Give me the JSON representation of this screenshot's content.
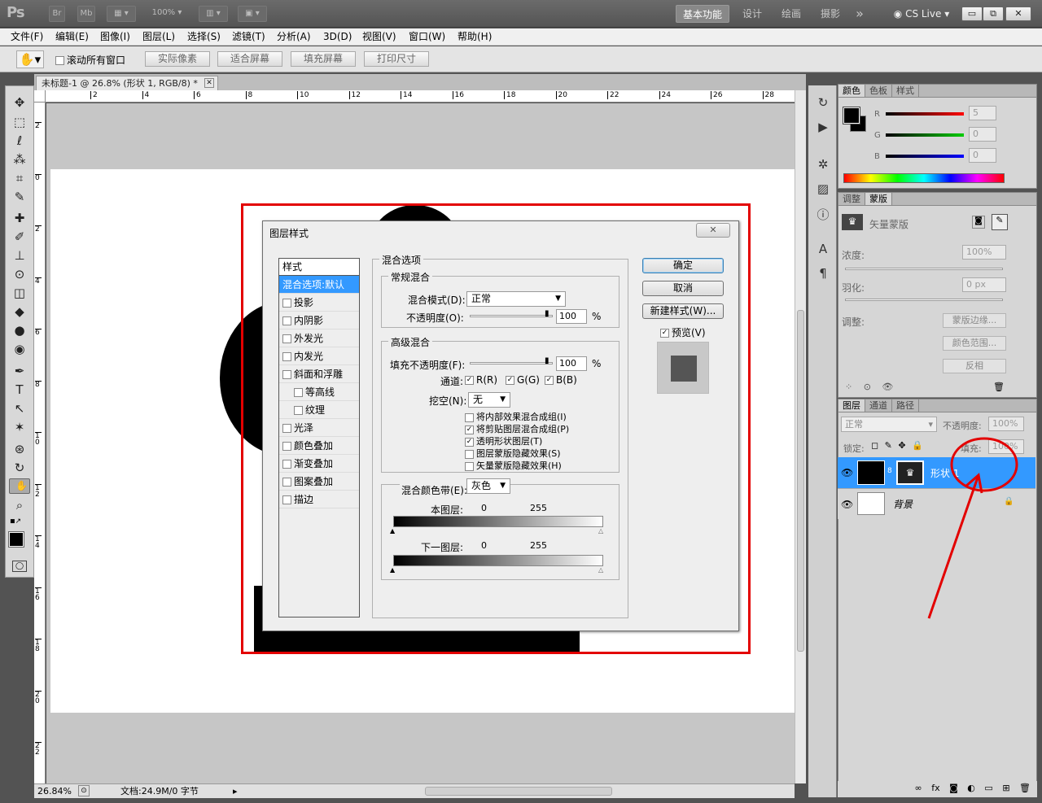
{
  "app": {
    "logo": "Ps",
    "br_label": "Br",
    "mb_label": "Mb",
    "zoom_select": "100%",
    "workspaces": [
      "基本功能",
      "设计",
      "绘画",
      "摄影"
    ],
    "more": "»",
    "cslive": "CS Live",
    "win_min": "▭",
    "win_max": "⧉",
    "win_close": "✕"
  },
  "menubar": [
    "文件(F)",
    "编辑(E)",
    "图像(I)",
    "图层(L)",
    "选择(S)",
    "滤镜(T)",
    "分析(A)",
    "3D(D)",
    "视图(V)",
    "窗口(W)",
    "帮助(H)"
  ],
  "options": {
    "scroll_all": "滚动所有窗口",
    "buttons": [
      "实际像素",
      "适合屏幕",
      "填充屏幕",
      "打印尺寸"
    ]
  },
  "document": {
    "tab_title": "未标题-1 @ 26.8% (形状 1, RGB/8) *",
    "zoom": "26.84%",
    "doc_size": "文档:24.9M/0 字节"
  },
  "rulers": {
    "top": [
      "2",
      "4",
      "6",
      "8",
      "10",
      "12",
      "14",
      "16",
      "18",
      "20",
      "22",
      "24",
      "26",
      "28"
    ],
    "left": [
      "2",
      "0",
      "2",
      "4",
      "6",
      "8",
      "1 0",
      "1 2",
      "1 4",
      "1 6",
      "1 8",
      "2 0",
      "2 2"
    ]
  },
  "tools": [
    "✥",
    "⬚",
    "ℓ",
    "⁂",
    "⌗",
    "✎",
    "✚",
    "✐",
    "⊥",
    "⊙",
    "◫",
    "◆",
    "●",
    "◉",
    "✒",
    "T",
    "↖",
    "✶",
    "⊛",
    "↻",
    "✋",
    "⌕"
  ],
  "dialog": {
    "title": "图层样式",
    "styles_header": "样式",
    "styles": [
      {
        "label": "混合选项:默认",
        "active": true,
        "checkbox": false
      },
      {
        "label": "投影",
        "checkbox": true
      },
      {
        "label": "内阴影",
        "checkbox": true
      },
      {
        "label": "外发光",
        "checkbox": true
      },
      {
        "label": "内发光",
        "checkbox": true
      },
      {
        "label": "斜面和浮雕",
        "checkbox": true
      },
      {
        "label": "等高线",
        "checkbox": true,
        "indent": true
      },
      {
        "label": "纹理",
        "checkbox": true,
        "indent": true
      },
      {
        "label": "光泽",
        "checkbox": true
      },
      {
        "label": "颜色叠加",
        "checkbox": true
      },
      {
        "label": "渐变叠加",
        "checkbox": true
      },
      {
        "label": "图案叠加",
        "checkbox": true
      },
      {
        "label": "描边",
        "checkbox": true
      }
    ],
    "blend_options_title": "混合选项",
    "general_title": "常规混合",
    "blend_mode_label": "混合模式(D):",
    "blend_mode_value": "正常",
    "opacity_label": "不透明度(O):",
    "opacity_value": "100",
    "pct": "%",
    "advanced_title": "高级混合",
    "fill_opacity_label": "填充不透明度(F):",
    "fill_opacity_value": "100",
    "channels_label": "通道:",
    "channels": [
      "R(R)",
      "G(G)",
      "B(B)"
    ],
    "knockout_label": "挖空(N):",
    "knockout_value": "无",
    "adv_checks": [
      {
        "label": "将内部效果混合成组(I)",
        "checked": false
      },
      {
        "label": "将剪贴图层混合成组(P)",
        "checked": true
      },
      {
        "label": "透明形状图层(T)",
        "checked": true
      },
      {
        "label": "图层蒙版隐藏效果(S)",
        "checked": false
      },
      {
        "label": "矢量蒙版隐藏效果(H)",
        "checked": false
      }
    ],
    "blend_if_label": "混合颜色带(E):",
    "blend_if_value": "灰色",
    "this_layer_label": "本图层:",
    "underlying_label": "下一图层:",
    "range_min": "0",
    "range_max": "255",
    "ok": "确定",
    "cancel": "取消",
    "new_style": "新建样式(W)...",
    "preview": "预览(V)",
    "close": "✕"
  },
  "color_panel": {
    "tabs": [
      "颜色",
      "色板",
      "样式"
    ],
    "r_label": "R",
    "g_label": "G",
    "b_label": "B",
    "r_value": "5",
    "g_value": "0",
    "b_value": "0"
  },
  "mask_panel": {
    "tabs": [
      "调整",
      "蒙版"
    ],
    "vector_mask": "矢量蒙版",
    "density_label": "浓度:",
    "density_value": "100%",
    "feather_label": "羽化:",
    "feather_value": "0 px",
    "refine_label": "调整:",
    "mask_edge": "蒙版边缘...",
    "color_range": "颜色范围...",
    "invert": "反相"
  },
  "layers_panel": {
    "tabs": [
      "图层",
      "通道",
      "路径"
    ],
    "blend_mode": "正常",
    "opacity_label": "不透明度:",
    "opacity_value": "100%",
    "lock_label": "锁定:",
    "fill_label": "填充:",
    "fill_value": "100%",
    "layers": [
      {
        "name": "形状 1",
        "selected": true
      },
      {
        "name": "背景",
        "selected": false
      }
    ],
    "footer_icons": [
      "∞",
      "fx",
      "◙",
      "◐",
      "▭",
      "⊞",
      "🗑"
    ]
  },
  "colors": {
    "accent_blue": "#3399ff",
    "annotation_red": "#e30000",
    "layer_selected": "#3399ff"
  }
}
